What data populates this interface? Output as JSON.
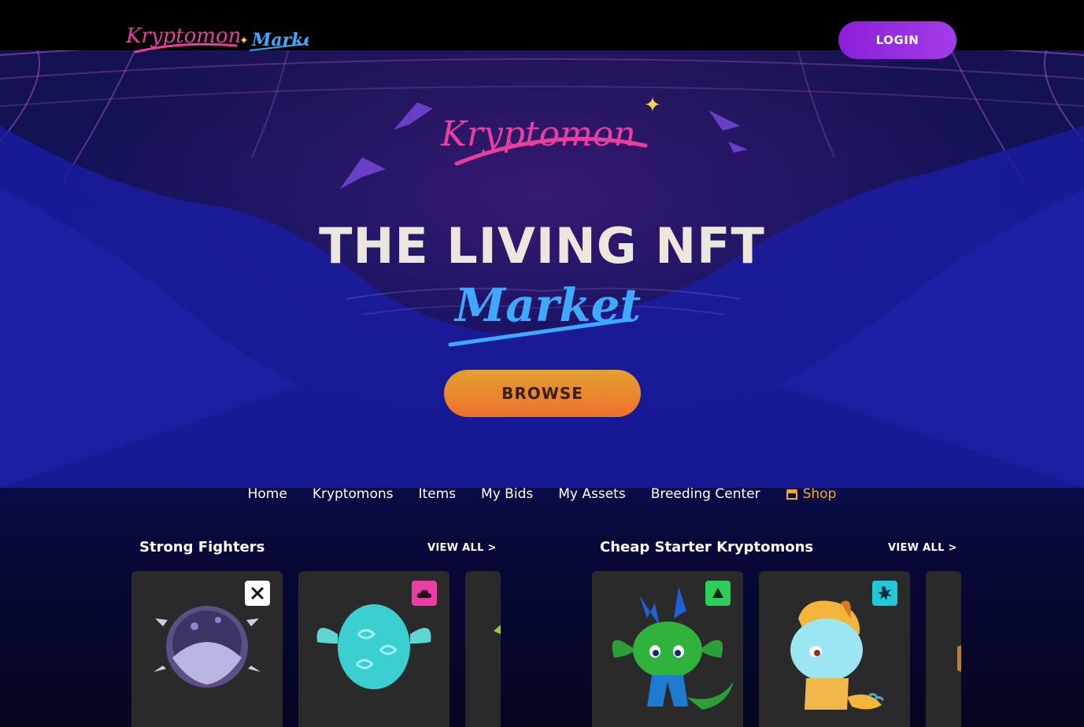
{
  "header": {
    "logo_text": "Kryptomon",
    "logo_sub": "Market",
    "login_label": "LOGIN"
  },
  "hero": {
    "logo_text": "Kryptomon",
    "headline": "THE LIVING NFT",
    "headline_script": "Market",
    "browse_label": "BROWSE"
  },
  "nav": {
    "items": [
      "Home",
      "Kryptomons",
      "Items",
      "My Bids",
      "My Assets",
      "Breeding Center"
    ],
    "shop_label": "Shop"
  },
  "sections": [
    {
      "title": "Strong Fighters",
      "view_all": "VIEW ALL >",
      "cards": [
        {
          "kind": "egg-ghost",
          "badge_icon": "x-icon",
          "badge_color": "#ffffff"
        },
        {
          "kind": "egg-air",
          "badge_icon": "cloud-icon",
          "badge_color": "#e83fa5"
        },
        {
          "kind": "partial"
        }
      ]
    },
    {
      "title": "Cheap Starter Kryptomons",
      "view_all": "VIEW ALL >",
      "cards": [
        {
          "kind": "grass-dragon",
          "badge_icon": "triangle-icon",
          "badge_color": "#2ecc5a"
        },
        {
          "kind": "ice-creature",
          "badge_icon": "burst-icon",
          "badge_color": "#22c7d8"
        },
        {
          "kind": "partial"
        }
      ]
    }
  ],
  "colors": {
    "accent_pink": "#e93e9f",
    "accent_blue": "#3fa8ff",
    "login_purple": "#9a2ee0",
    "browse_orange": "#ec7a2f",
    "shop_orange": "#f2a93b"
  }
}
